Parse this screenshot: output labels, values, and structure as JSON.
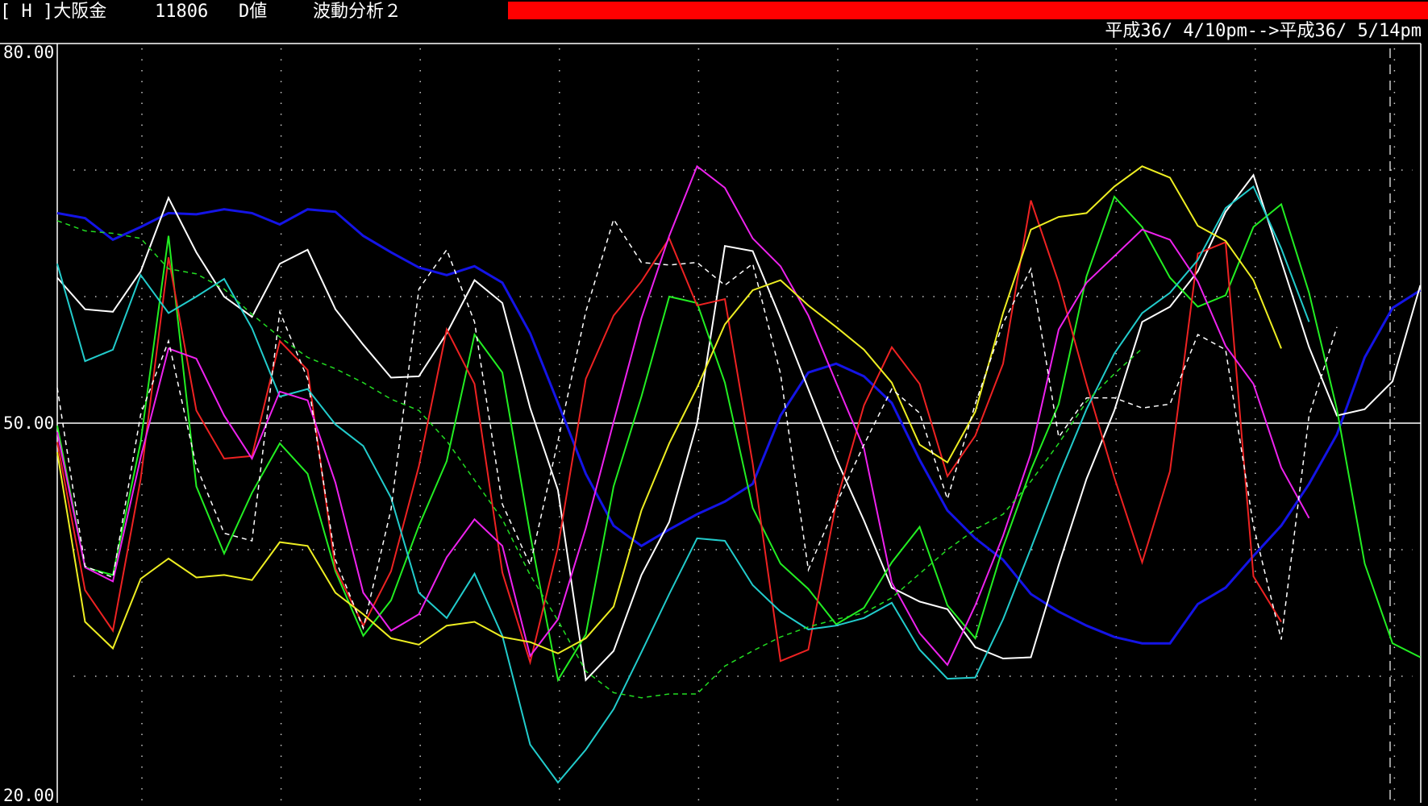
{
  "header": {
    "code_label": "[ H ]大阪金",
    "number": "11806",
    "mode": "D値",
    "analysis": "波動分析２",
    "progress": 1.0,
    "progress_color": "#ff0000",
    "date_range": "平成36/ 4/10pm-->平成36/ 5/14pm"
  },
  "chart_data": {
    "type": "line",
    "title": "",
    "xlabel": "",
    "ylabel": "",
    "ylim": [
      20,
      80
    ],
    "yticks": [
      {
        "value": 80,
        "label": "80.00"
      },
      {
        "value": 50,
        "label": "50.00"
      },
      {
        "value": 20,
        "label": "20.00"
      }
    ],
    "reference_line": 50,
    "grid": "dotted",
    "background": "#000000",
    "x": [
      1,
      2,
      3,
      4,
      5,
      6,
      7,
      8,
      9,
      10,
      11,
      12,
      13,
      14,
      15,
      16,
      17,
      18,
      19,
      20,
      21,
      22,
      23,
      24,
      25,
      26,
      27,
      28,
      29,
      30,
      31,
      32,
      33,
      34,
      35,
      36,
      37,
      38,
      39,
      40,
      41,
      42,
      43,
      44,
      45,
      46,
      47,
      48,
      49,
      50
    ],
    "series": [
      {
        "color": "#1414e6",
        "style": "solid",
        "width": 3,
        "values": [
          66.6,
          66.2,
          64.5,
          65.5,
          66.6,
          66.5,
          66.9,
          66.6,
          65.7,
          66.9,
          66.7,
          64.8,
          63.5,
          62.3,
          61.7,
          62.4,
          61.1,
          57.1,
          51.6,
          46.0,
          41.9,
          40.3,
          41.6,
          42.8,
          43.8,
          45.2,
          50.6,
          54.0,
          54.7,
          53.7,
          51.6,
          47.1,
          43.1,
          40.9,
          39.2,
          36.5,
          35.1,
          34.0,
          33.1,
          32.6,
          32.6,
          35.7,
          37.0,
          39.5,
          41.9,
          45.2,
          49.1,
          55.2,
          59.1,
          60.5
        ]
      },
      {
        "color": "#ffffff",
        "style": "solid",
        "width": 2,
        "values": [
          61.5,
          59.0,
          58.8,
          62.0,
          67.8,
          63.5,
          60.0,
          58.4,
          62.6,
          63.7,
          59.0,
          56.2,
          53.6,
          53.7,
          57.1,
          61.3,
          59.5,
          51.2,
          44.7,
          29.7,
          32.0,
          38.0,
          42.2,
          50.0,
          64.0,
          63.6,
          58.3,
          52.7,
          47.2,
          42.3,
          37.0,
          35.9,
          35.3,
          32.3,
          31.4,
          31.5,
          38.8,
          45.6,
          51.0,
          58.0,
          59.2,
          62.0,
          66.7,
          69.6,
          62.8,
          56.0,
          50.6,
          51.1,
          53.3,
          60.9
        ]
      },
      {
        "color": "#22ee22",
        "style": "solid",
        "width": 2,
        "values": [
          49.8,
          38.6,
          38.0,
          48.5,
          64.8,
          45.0,
          39.7,
          44.5,
          48.4,
          46.0,
          38.3,
          33.2,
          36.0,
          41.9,
          47.0,
          57.0,
          54.0,
          41.2,
          29.7,
          33.3,
          45.0,
          52.1,
          60.0,
          59.5,
          53.2,
          43.3,
          38.9,
          36.9,
          34.1,
          35.4,
          39.0,
          41.8,
          35.6,
          33.0,
          40.2,
          46.3,
          51.5,
          61.6,
          67.9,
          65.5,
          61.5,
          59.2,
          60.1,
          65.5,
          67.3,
          60.3,
          51.1,
          38.9,
          32.6,
          31.5
        ]
      },
      {
        "color": "#ee2222",
        "style": "solid",
        "width": 2,
        "values": [
          48.5,
          36.8,
          33.6,
          45.6,
          63.1,
          51.0,
          47.2,
          47.4,
          56.5,
          54.2,
          38.5,
          34.0,
          38.3,
          46.6,
          57.4,
          53.1,
          38.2,
          31.1,
          40.2,
          53.5,
          58.5,
          61.2,
          64.6,
          59.3,
          59.8,
          46.8,
          31.2,
          32.1,
          43.7,
          51.4,
          56.0,
          53.1,
          45.8,
          49.0,
          54.7,
          67.6,
          61.1,
          53.1,
          45.7,
          39.0,
          46.2,
          63.4,
          64.3,
          37.9,
          34.3
        ]
      },
      {
        "color": "#22cccc",
        "style": "solid",
        "width": 2,
        "values": [
          62.6,
          54.9,
          55.8,
          61.7,
          58.7,
          60.0,
          61.4,
          57.5,
          52.1,
          52.7,
          49.9,
          48.2,
          44.1,
          36.6,
          34.6,
          38.1,
          33.2,
          24.6,
          21.6,
          24.2,
          27.4,
          31.9,
          36.5,
          40.9,
          40.7,
          37.2,
          35.1,
          33.7,
          34.0,
          34.6,
          35.8,
          32.1,
          29.8,
          29.9,
          34.5,
          40.1,
          45.8,
          51.1,
          55.5,
          58.7,
          60.3,
          62.9,
          67.0,
          68.7,
          63.8,
          58.0
        ]
      },
      {
        "color": "#ee22ee",
        "style": "solid",
        "width": 2,
        "values": [
          49.3,
          38.6,
          37.5,
          47.3,
          55.9,
          55.1,
          50.6,
          47.2,
          52.5,
          51.8,
          45.3,
          36.6,
          33.6,
          34.9,
          39.4,
          42.4,
          40.3,
          31.6,
          34.5,
          41.7,
          50.1,
          58.3,
          64.8,
          70.3,
          68.6,
          64.6,
          62.4,
          58.5,
          53.2,
          48.0,
          37.4,
          33.4,
          30.9,
          35.6,
          41.1,
          47.6,
          57.4,
          61.1,
          63.2,
          65.3,
          64.5,
          61.2,
          56.1,
          53.1,
          46.5,
          42.5
        ]
      },
      {
        "color": "#eeee22",
        "style": "solid",
        "width": 2,
        "values": [
          47.7,
          34.3,
          32.2,
          37.7,
          39.3,
          37.8,
          38.0,
          37.6,
          40.6,
          40.3,
          36.6,
          34.9,
          33.0,
          32.5,
          34.0,
          34.3,
          33.1,
          32.7,
          31.8,
          33.0,
          35.5,
          43.1,
          48.4,
          52.8,
          57.8,
          60.5,
          61.3,
          59.3,
          57.6,
          55.8,
          53.2,
          48.3,
          46.9,
          50.9,
          58.7,
          65.3,
          66.3,
          66.6,
          68.7,
          70.3,
          69.4,
          65.6,
          64.4,
          61.3,
          55.9
        ]
      },
      {
        "color": "#ffffff",
        "style": "dashed",
        "width": 1.5,
        "values": [
          52.8,
          38.7,
          37.8,
          50.7,
          56.5,
          46.6,
          41.3,
          40.7,
          58.8,
          53.5,
          39.2,
          33.8,
          43.2,
          60.6,
          63.7,
          58.0,
          43.6,
          38.8,
          48.6,
          58.8,
          66.1,
          62.7,
          62.5,
          62.7,
          60.9,
          62.6,
          53.9,
          38.4,
          43.6,
          48.3,
          52.7,
          50.8,
          44.0,
          51.5,
          57.9,
          62.2,
          48.9,
          52.0,
          52.0,
          51.2,
          51.5,
          57.0,
          55.8,
          41.9,
          32.9,
          50.6,
          57.6
        ]
      },
      {
        "color": "#22dd22",
        "style": "dashed",
        "width": 1.5,
        "values": [
          66.0,
          65.2,
          65.0,
          64.6,
          62.2,
          61.8,
          60.6,
          58.6,
          56.8,
          55.2,
          54.3,
          53.2,
          51.9,
          51.0,
          48.6,
          45.5,
          42.4,
          38.0,
          34.4,
          30.4,
          28.7,
          28.3,
          28.6,
          28.6,
          30.8,
          32.0,
          33.1,
          33.9,
          34.5,
          35.0,
          36.2,
          38.1,
          40.0,
          41.6,
          42.8,
          45.4,
          48.4,
          51.7,
          53.9,
          55.9
        ]
      }
    ]
  }
}
